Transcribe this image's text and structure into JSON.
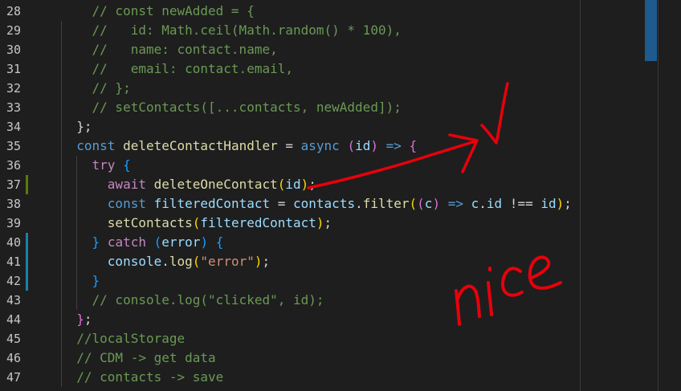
{
  "editor": {
    "line_numbers": [
      "28",
      "29",
      "30",
      "31",
      "32",
      "33",
      "34",
      "35",
      "36",
      "37",
      "38",
      "39",
      "40",
      "41",
      "42",
      "43",
      "44",
      "45",
      "46",
      "47"
    ],
    "lines": [
      [
        {
          "t": "    // const newAdded = {",
          "c": "comment"
        }
      ],
      [
        {
          "t": "    //   id: Math.ceil(Math.random() * 100),",
          "c": "comment"
        }
      ],
      [
        {
          "t": "    //   name: contact.name,",
          "c": "comment"
        }
      ],
      [
        {
          "t": "    //   email: contact.email,",
          "c": "comment"
        }
      ],
      [
        {
          "t": "    // };",
          "c": "comment"
        }
      ],
      [
        {
          "t": "    // setContacts([...contacts, newAdded]);",
          "c": "comment"
        }
      ],
      [
        {
          "t": "  };",
          "c": "text"
        }
      ],
      [
        {
          "t": "  ",
          "c": "text"
        },
        {
          "t": "const",
          "c": "keyword"
        },
        {
          "t": " ",
          "c": "text"
        },
        {
          "t": "deleteContactHandler",
          "c": "func"
        },
        {
          "t": " = ",
          "c": "text"
        },
        {
          "t": "async",
          "c": "keyword"
        },
        {
          "t": " (",
          "c": "br2"
        },
        {
          "t": "id",
          "c": "var"
        },
        {
          "t": ")",
          "c": "br2"
        },
        {
          "t": " ",
          "c": "text"
        },
        {
          "t": "=>",
          "c": "keyword"
        },
        {
          "t": " ",
          "c": "text"
        },
        {
          "t": "{",
          "c": "br2"
        }
      ],
      [
        {
          "t": "    ",
          "c": "text"
        },
        {
          "t": "try",
          "c": "control"
        },
        {
          "t": " ",
          "c": "text"
        },
        {
          "t": "{",
          "c": "br3"
        }
      ],
      [
        {
          "t": "      ",
          "c": "text"
        },
        {
          "t": "await",
          "c": "control"
        },
        {
          "t": " ",
          "c": "text"
        },
        {
          "t": "deleteOneContact",
          "c": "func"
        },
        {
          "t": "(",
          "c": "br1"
        },
        {
          "t": "id",
          "c": "var"
        },
        {
          "t": ")",
          "c": "br1"
        },
        {
          "t": ";",
          "c": "text"
        }
      ],
      [
        {
          "t": "      ",
          "c": "text"
        },
        {
          "t": "const",
          "c": "keyword"
        },
        {
          "t": " ",
          "c": "text"
        },
        {
          "t": "filteredContact",
          "c": "var"
        },
        {
          "t": " = ",
          "c": "text"
        },
        {
          "t": "contacts",
          "c": "var"
        },
        {
          "t": ".",
          "c": "text"
        },
        {
          "t": "filter",
          "c": "func"
        },
        {
          "t": "(",
          "c": "br1"
        },
        {
          "t": "(",
          "c": "br2"
        },
        {
          "t": "c",
          "c": "var"
        },
        {
          "t": ")",
          "c": "br2"
        },
        {
          "t": " ",
          "c": "text"
        },
        {
          "t": "=>",
          "c": "keyword"
        },
        {
          "t": " ",
          "c": "text"
        },
        {
          "t": "c",
          "c": "var"
        },
        {
          "t": ".",
          "c": "text"
        },
        {
          "t": "id",
          "c": "var"
        },
        {
          "t": " !== ",
          "c": "text"
        },
        {
          "t": "id",
          "c": "var"
        },
        {
          "t": ")",
          "c": "br1"
        },
        {
          "t": ";",
          "c": "text"
        }
      ],
      [
        {
          "t": "      ",
          "c": "text"
        },
        {
          "t": "setContacts",
          "c": "func"
        },
        {
          "t": "(",
          "c": "br1"
        },
        {
          "t": "filteredContact",
          "c": "var"
        },
        {
          "t": ")",
          "c": "br1"
        },
        {
          "t": ";",
          "c": "text"
        }
      ],
      [
        {
          "t": "    ",
          "c": "text"
        },
        {
          "t": "}",
          "c": "br3"
        },
        {
          "t": " ",
          "c": "text"
        },
        {
          "t": "catch",
          "c": "control"
        },
        {
          "t": " ",
          "c": "text"
        },
        {
          "t": "(",
          "c": "br3"
        },
        {
          "t": "error",
          "c": "var"
        },
        {
          "t": ")",
          "c": "br3"
        },
        {
          "t": " ",
          "c": "text"
        },
        {
          "t": "{",
          "c": "br3"
        }
      ],
      [
        {
          "t": "      ",
          "c": "text"
        },
        {
          "t": "console",
          "c": "var"
        },
        {
          "t": ".",
          "c": "text"
        },
        {
          "t": "log",
          "c": "func"
        },
        {
          "t": "(",
          "c": "br1"
        },
        {
          "t": "\"error\"",
          "c": "string"
        },
        {
          "t": ")",
          "c": "br1"
        },
        {
          "t": ";",
          "c": "text"
        }
      ],
      [
        {
          "t": "    ",
          "c": "text"
        },
        {
          "t": "}",
          "c": "br3"
        }
      ],
      [
        {
          "t": "    // console.log(\"clicked\", id);",
          "c": "comment"
        }
      ],
      [
        {
          "t": "  ",
          "c": "text"
        },
        {
          "t": "}",
          "c": "br2"
        },
        {
          "t": ";",
          "c": "text"
        }
      ],
      [
        {
          "t": "  //localStorage",
          "c": "comment"
        }
      ],
      [
        {
          "t": "  // CDM -> get data",
          "c": "comment"
        }
      ],
      [
        {
          "t": "  // contacts -> save",
          "c": "comment"
        }
      ]
    ],
    "modified_lines": {
      "37": "#587c0c",
      "40": "#1b81a8",
      "41": "#1b81a8",
      "42": "#1b81a8"
    }
  },
  "annotation": {
    "text": "nice",
    "color": "#e8000b"
  },
  "colors": {
    "background": "#1e1e1e",
    "comment": "#6a9955",
    "keyword": "#569cd6",
    "control": "#c586c0",
    "variable": "#9cdcfe",
    "function": "#dcdcaa",
    "string": "#ce9178",
    "scroll_thumb": "#1f5a8f"
  }
}
